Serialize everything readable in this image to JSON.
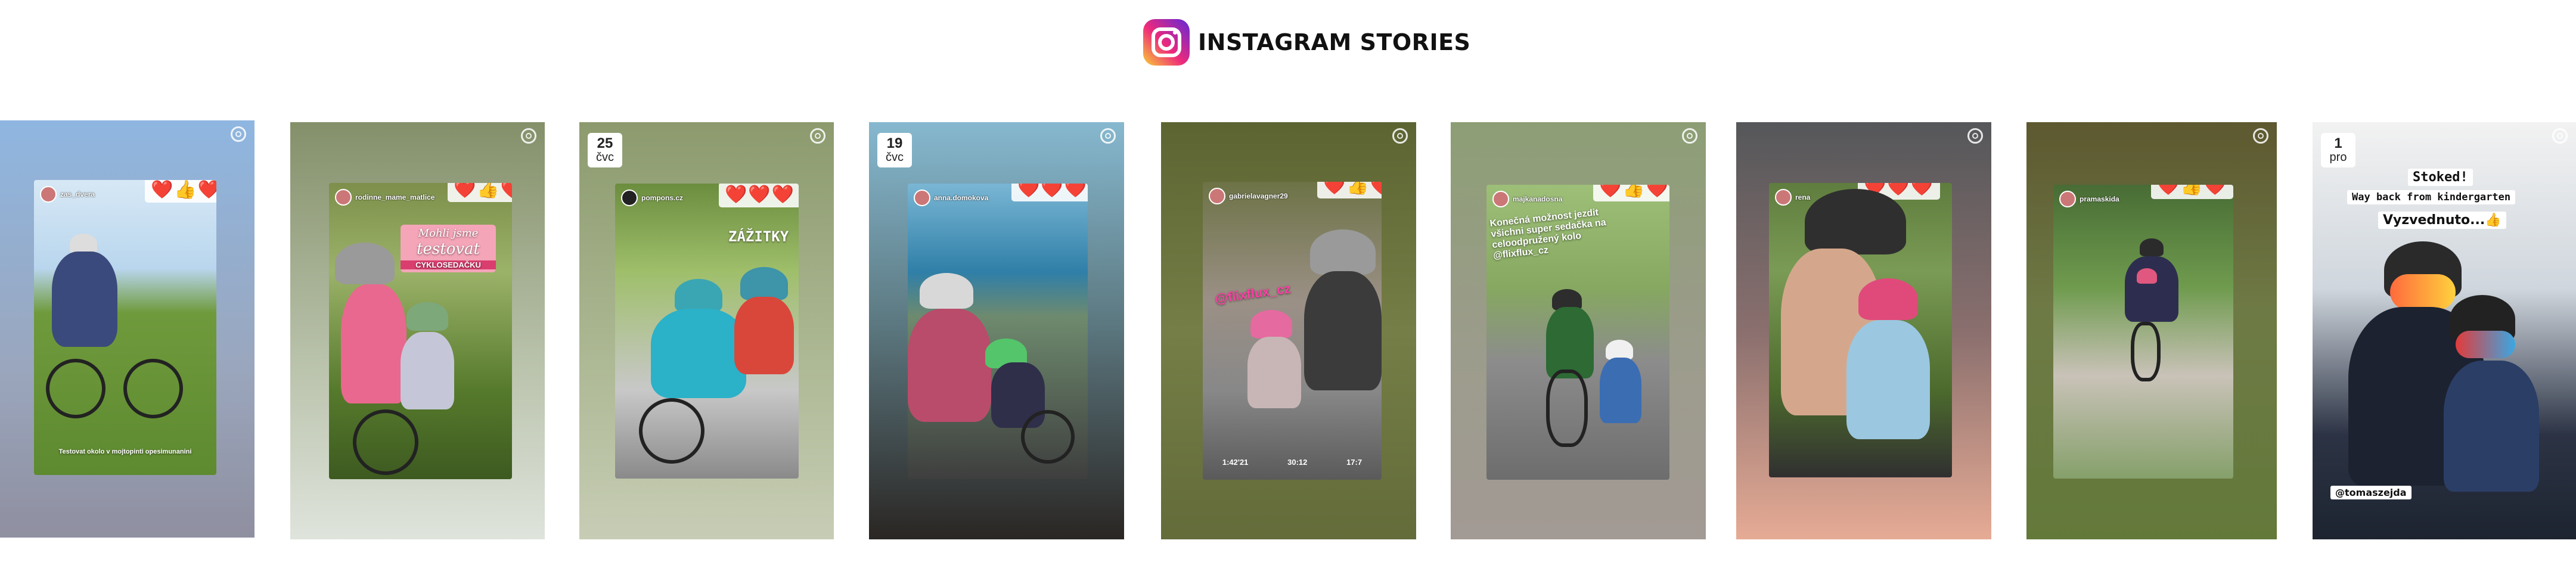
{
  "header": {
    "title": "INSTAGRAM STORIES",
    "logo_icon": "instagram-icon"
  },
  "stories": [
    {
      "username": "zas_dvera",
      "reactions": "❤️👍❤️",
      "caption": "Testovat okolo v mojtopinti opesimunanini"
    },
    {
      "username": "rodinne_mame_matlice",
      "reactions": "❤️👍❤️",
      "caption_script": "Mohli jsme",
      "caption_big": "testovat",
      "caption_tag": "CYKLOSEDAČKU"
    },
    {
      "username": "pompons.cz",
      "date_day": "25",
      "date_month": "čvc",
      "reactions": "❤️❤️❤️",
      "caption": "ZÁŽITKY"
    },
    {
      "username": "anna.domokova",
      "date_day": "19",
      "date_month": "čvc",
      "reactions": "❤️❤️❤️"
    },
    {
      "username": "gabrielavagner29",
      "reactions": "❤️👍❤️",
      "tag": "@flixflux_cz",
      "stats": [
        "1:42'21",
        "30:12",
        "17:7"
      ]
    },
    {
      "username": "majkanadosna",
      "reactions": "❤️👍❤️",
      "caption": "Konečná možnost jezdit všichni super sedačka na celoodpružený kolo @flixflux_cz"
    },
    {
      "username": "rena",
      "reactions": "❤️❤️❤️"
    },
    {
      "username": "pramaskida",
      "reactions": "❤️👍❤️"
    },
    {
      "username": "@tomaszejda",
      "date_day": "1",
      "date_month": "pro",
      "line1": "Stoked!",
      "line2": "Way back from kindergarten",
      "line3": "Vyzvednuto...👍"
    }
  ]
}
